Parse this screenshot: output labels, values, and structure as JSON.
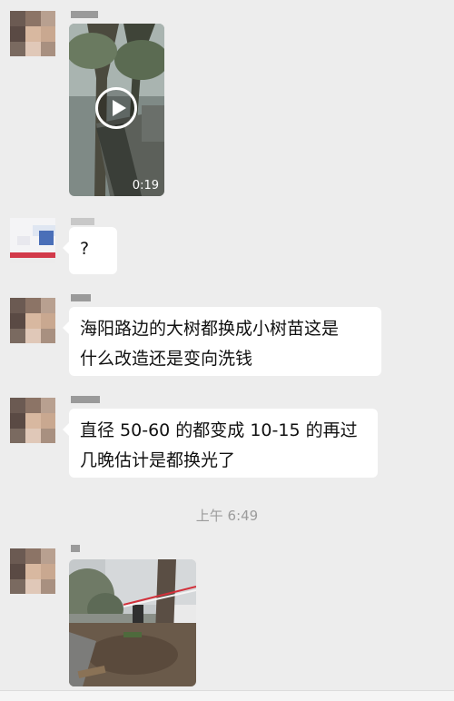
{
  "messages": [
    {
      "type": "video",
      "duration": "0:19"
    },
    {
      "type": "text",
      "text": "?"
    },
    {
      "type": "text",
      "lines": [
        "海阳路边的大树都换成小树苗这是",
        "什么改造还是变向洗钱"
      ]
    },
    {
      "type": "text",
      "lines": [
        "直径 50-60 的都变成 10-15 的再过",
        "几晚估计是都换光了"
      ]
    },
    {
      "type": "image"
    }
  ],
  "timestamp": "上午 6:49",
  "colors": {
    "background": "#ededed",
    "bubble": "#ffffff",
    "timestamp": "#9c9c9c"
  }
}
